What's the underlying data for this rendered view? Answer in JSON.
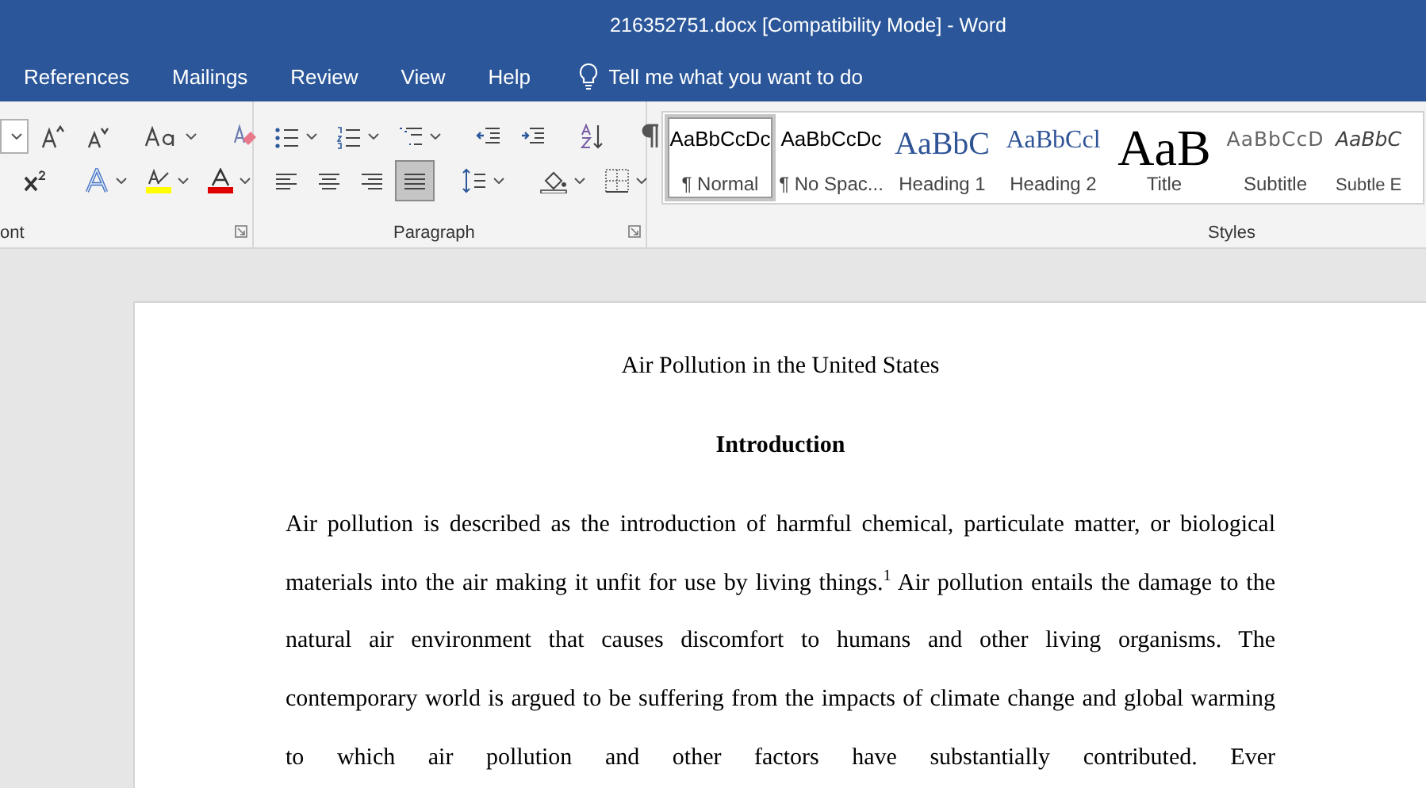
{
  "window": {
    "title": "216352751.docx [Compatibility Mode] - Word"
  },
  "tabs": [
    {
      "label": "References",
      "selected": false
    },
    {
      "label": "Mailings",
      "selected": false
    },
    {
      "label": "Review",
      "selected": false
    },
    {
      "label": "View",
      "selected": false
    },
    {
      "label": "Help",
      "selected": false
    }
  ],
  "tell_me": {
    "placeholder": "Tell me what you want to do"
  },
  "font_group": {
    "label": "ont"
  },
  "paragraph_group": {
    "label": "Paragraph",
    "alignments": [
      {
        "kind": "left",
        "selected": false
      },
      {
        "kind": "center",
        "selected": false
      },
      {
        "kind": "right",
        "selected": false
      },
      {
        "kind": "justify",
        "selected": true
      }
    ]
  },
  "styles_group": {
    "label": "Styles",
    "styles": [
      {
        "kind": "normal",
        "preview": "AaBbCcDc",
        "name": "¶ Normal",
        "selected": true
      },
      {
        "kind": "nospacing",
        "preview": "AaBbCcDc",
        "name": "¶ No Spac...",
        "selected": false
      },
      {
        "kind": "heading1",
        "preview": "AaBbC",
        "name": "Heading 1",
        "selected": false
      },
      {
        "kind": "heading2",
        "preview": "AaBbCcl",
        "name": "Heading 2",
        "selected": false
      },
      {
        "kind": "title",
        "preview": "AaB",
        "name": "Title",
        "selected": false
      },
      {
        "kind": "subtitle",
        "preview": "AaBbCcD",
        "name": "Subtitle",
        "selected": false
      },
      {
        "kind": "emphasis",
        "preview": "AaBbC",
        "name": "Subtle E",
        "selected": false
      }
    ]
  },
  "document": {
    "title": "Air Pollution in the United States",
    "heading": "Introduction",
    "paragraph": "Air pollution is described as the introduction of harmful chemical, particulate matter, or biological materials into the air making it unfit for use by living things.$^{1}$ Air pollution entails the damage to the natural air environment that causes discomfort to humans and other living organisms. The contemporary world is argued to be suffering from the impacts of climate change and global warming to which air pollution and other factors have substantially contributed. Ever"
  }
}
